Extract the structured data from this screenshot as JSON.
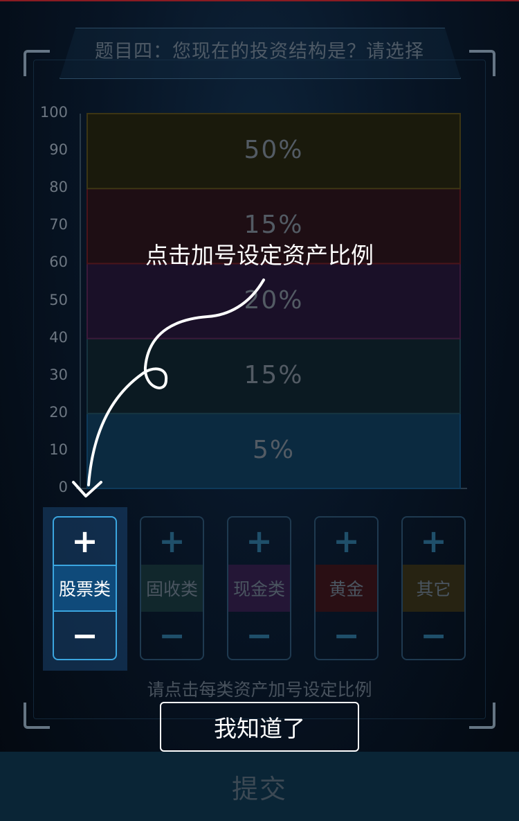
{
  "question": {
    "title": "题目四：您现在的投资结构是？请选择"
  },
  "chart_data": {
    "type": "bar",
    "stacked": true,
    "ylim": [
      0,
      100
    ],
    "yticks": [
      "100",
      "90",
      "80",
      "70",
      "60",
      "50",
      "40",
      "30",
      "20",
      "10",
      "0"
    ],
    "segments": [
      {
        "label": "5%",
        "from": 0,
        "to": 20,
        "color": "#0b2a40"
      },
      {
        "label": "15%",
        "from": 20,
        "to": 40,
        "color": "#0b1a22"
      },
      {
        "label": "20%",
        "from": 40,
        "to": 60,
        "color": "#1a1028"
      },
      {
        "label": "15%",
        "from": 60,
        "to": 80,
        "color": "#1e0e14"
      },
      {
        "label": "50%",
        "from": 80,
        "to": 100,
        "color": "#1a1a0c"
      }
    ],
    "segment_borders": [
      "#0e3a5a",
      "#17343f",
      "#3b1a3a",
      "#4a141a",
      "#3c3514"
    ]
  },
  "tip": {
    "text": "点击加号设定资产比例"
  },
  "assets": [
    {
      "label": "股票类",
      "plus": "+",
      "minus": "−",
      "color": "#0f4a7a",
      "active": true
    },
    {
      "label": "固收类",
      "plus": "+",
      "minus": "−",
      "color": "#11272c"
    },
    {
      "label": "现金类",
      "plus": "+",
      "minus": "−",
      "color": "#241636"
    },
    {
      "label": "黄金",
      "plus": "+",
      "minus": "−",
      "color": "#2a0f14"
    },
    {
      "label": "其它",
      "plus": "+",
      "minus": "−",
      "color": "#272312"
    }
  ],
  "hint": "请点击每类资产加号设定比例",
  "confirm_button": "我知道了",
  "submit_button": "提交"
}
